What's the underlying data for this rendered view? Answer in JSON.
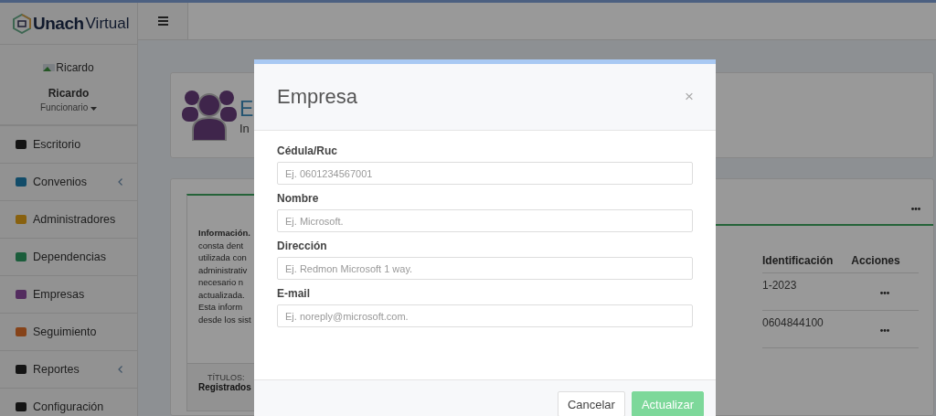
{
  "brand": {
    "bold": "Unach",
    "light": "Virtual"
  },
  "user": {
    "avatar_alt": "Ricardo",
    "name": "Ricardo",
    "role": "Funcionario"
  },
  "sidebar": {
    "items": [
      {
        "label": "Escritorio",
        "has_submenu": false
      },
      {
        "label": "Convenios",
        "has_submenu": true
      },
      {
        "label": "Administradores",
        "has_submenu": false
      },
      {
        "label": "Dependencias",
        "has_submenu": false
      },
      {
        "label": "Empresas",
        "has_submenu": false
      },
      {
        "label": "Seguimiento",
        "has_submenu": false
      },
      {
        "label": "Reportes",
        "has_submenu": true
      },
      {
        "label": "Configuración",
        "has_submenu": false
      }
    ]
  },
  "page_header": {
    "title": "E",
    "subtitle": "In"
  },
  "info": {
    "lines": [
      "**Información.**",
      "consta dent",
      "utilizada con",
      "administrativ",
      "necesario n",
      "actualizada.",
      "Esta inform",
      "desde los sist"
    ],
    "footer_label": "TÍTULOS:",
    "footer_value": "Registrados"
  },
  "table": {
    "columns": [
      "Identificación",
      "Acciones"
    ],
    "rows": [
      [
        "1-2023"
      ],
      [
        "0604844100"
      ]
    ]
  },
  "modal": {
    "title": "Empresa",
    "close": "×",
    "fields": [
      {
        "label": "Cédula/Ruc",
        "placeholder": "Ej. 0601234567001"
      },
      {
        "label": "Nombre",
        "placeholder": "Ej. Microsoft."
      },
      {
        "label": "Dirección",
        "placeholder": "Ej. Redmon Microsoft 1 way."
      },
      {
        "label": "E-mail",
        "placeholder": "Ej. noreply@microsoft.com."
      }
    ],
    "buttons": [
      {
        "label": "Cancelar",
        "kind": "secondary"
      },
      {
        "label": "Actualizar",
        "kind": "primary"
      }
    ]
  }
}
